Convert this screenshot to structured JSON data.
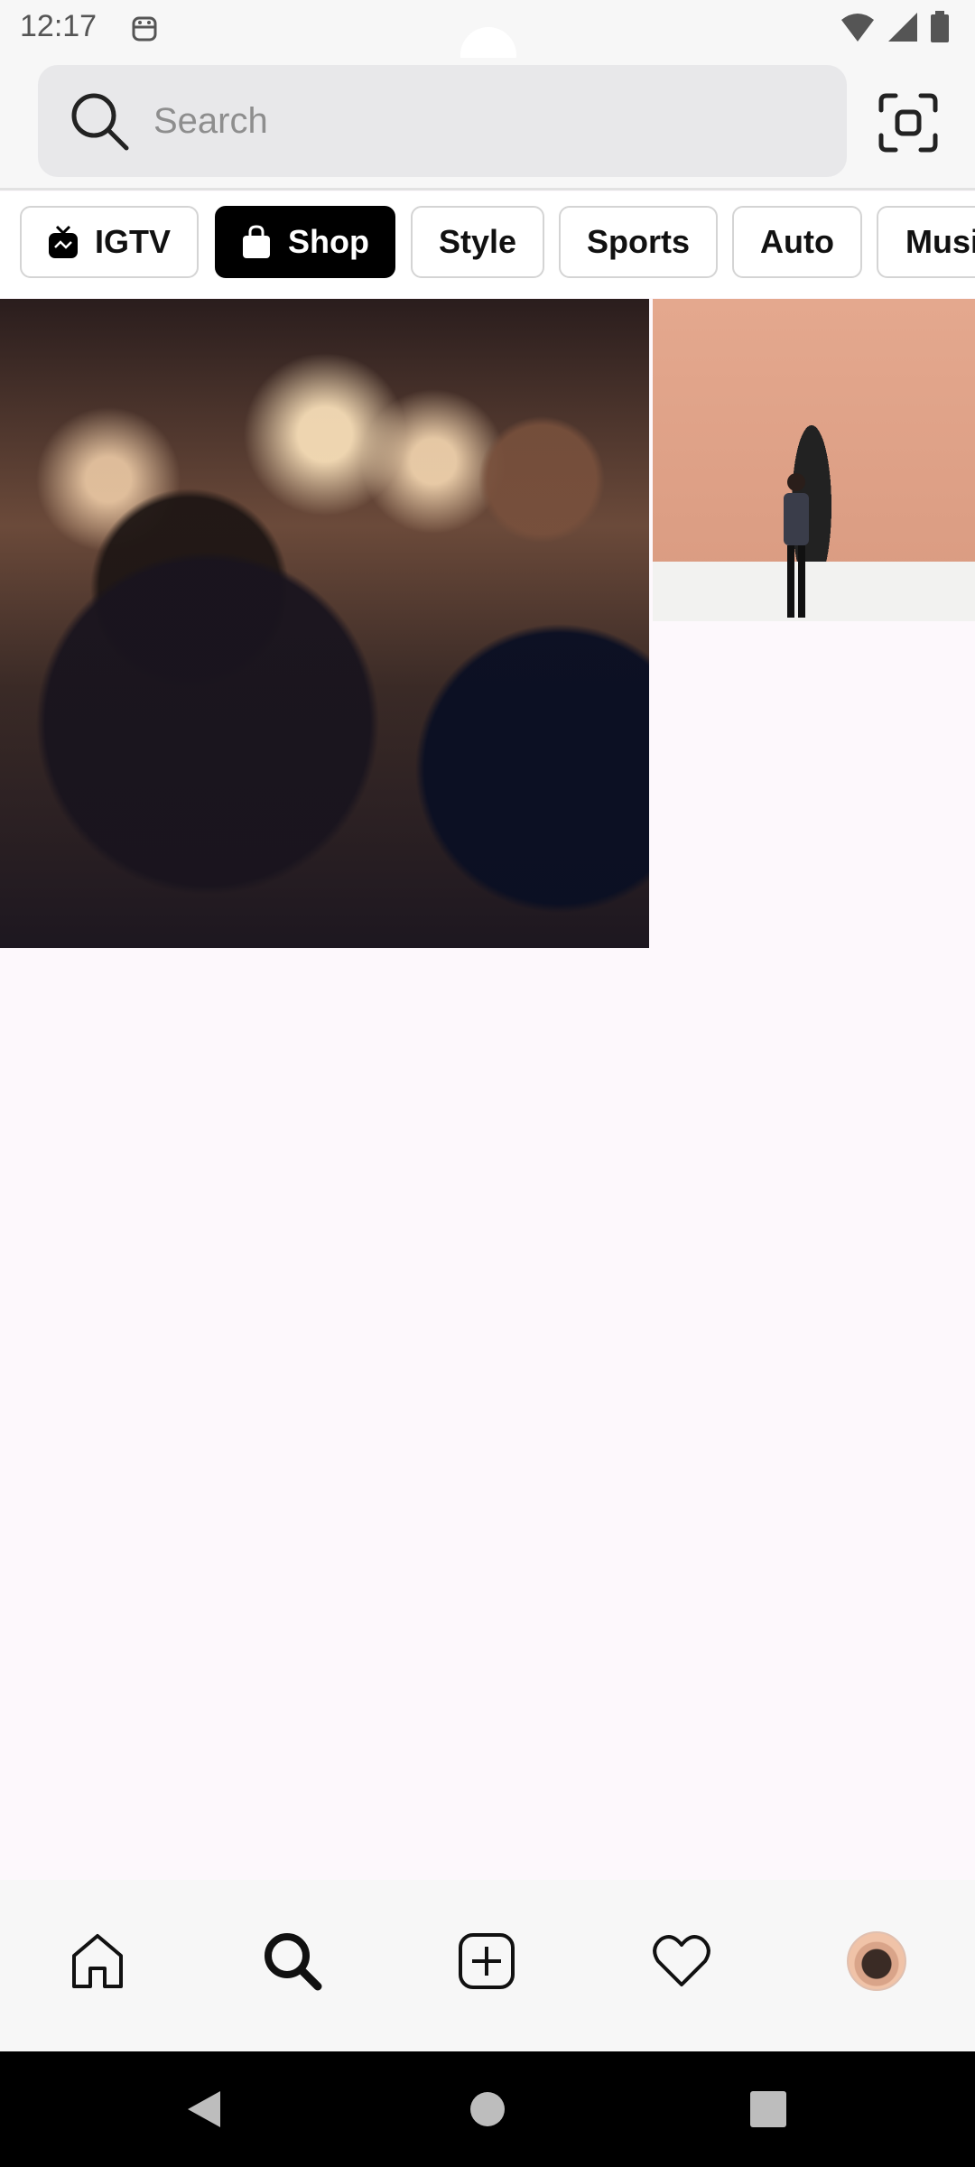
{
  "status_bar": {
    "time": "12:17",
    "left_icon": "android-debug-icon",
    "right_icons": [
      "wifi-icon",
      "signal-icon",
      "battery-icon"
    ]
  },
  "search": {
    "placeholder": "Search",
    "value": "",
    "scan_icon": "scan-icon"
  },
  "categories": {
    "items": [
      {
        "label": "IGTV",
        "icon": "igtv-icon",
        "active": false
      },
      {
        "label": "Shop",
        "icon": "shopping-bag-icon",
        "active": true
      },
      {
        "label": "Style",
        "active": false
      },
      {
        "label": "Sports",
        "active": false
      },
      {
        "label": "Auto",
        "active": false
      },
      {
        "label": "Musi",
        "active": false
      }
    ]
  },
  "grid": {
    "images": [
      "couple-celebration-photo",
      "man-against-pink-wall-photo"
    ]
  },
  "bottom_nav": {
    "items": [
      "home-icon",
      "search-icon",
      "create-post-icon",
      "activity-heart-icon",
      "profile-avatar"
    ]
  },
  "system_nav": {
    "items": [
      "back-button",
      "home-button",
      "recents-button"
    ]
  },
  "colors": {
    "active_chip_bg": "#000000",
    "page_bg": "#fdf8fc"
  }
}
